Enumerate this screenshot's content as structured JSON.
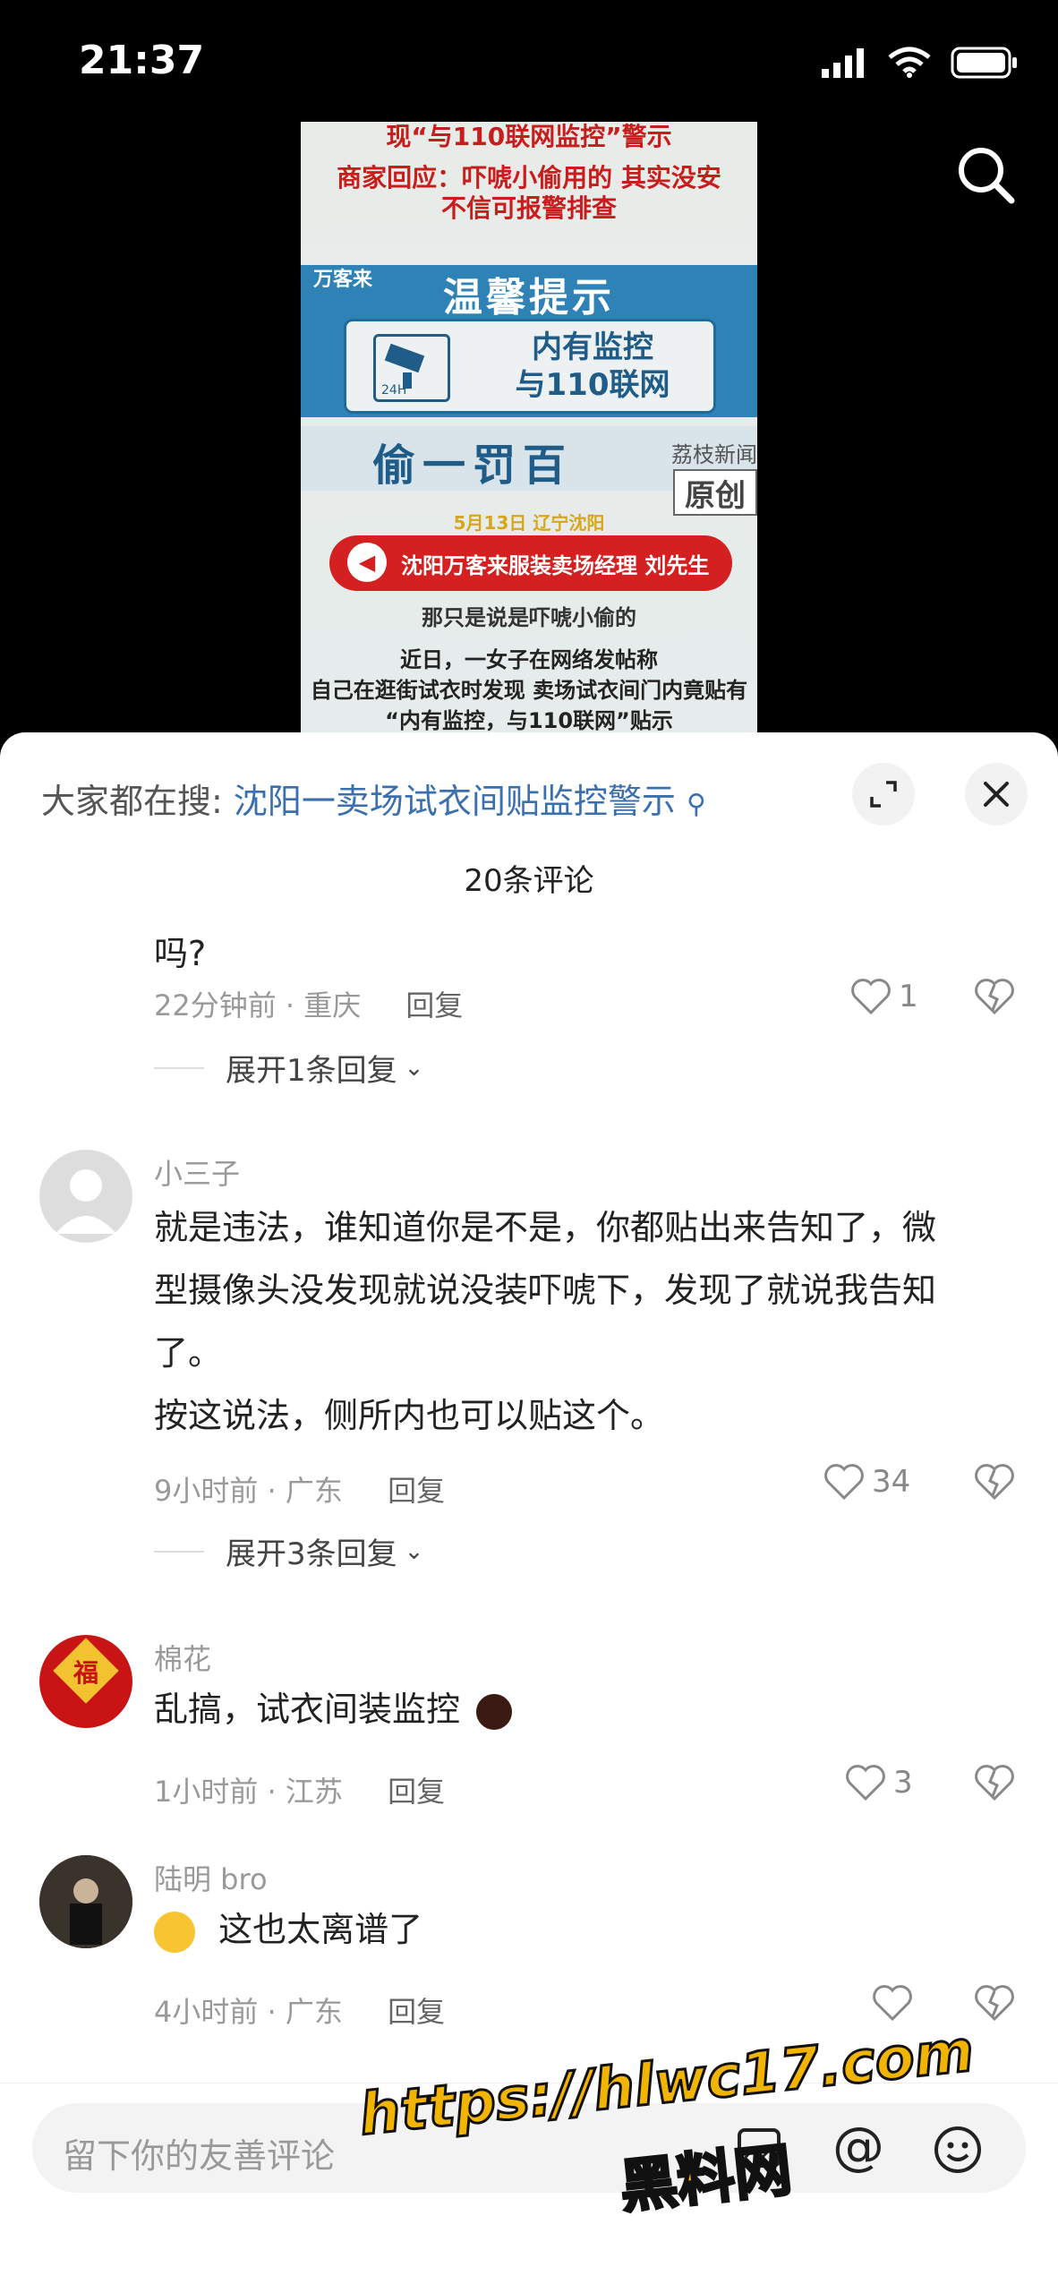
{
  "status_bar": {
    "time": "21:37"
  },
  "video": {
    "title": "现“与110联网监控”警示",
    "merchant_response": "商家回应：吓唬小偷用的 其实没安\n不信可报警排查",
    "brand": "万客来",
    "heading": "温馨提示",
    "box_text": "内有监控\n与110联网",
    "box_icon_label": "24H",
    "fine_text": "偷一罚百",
    "source": "荔枝新闻",
    "original_tag": "原创",
    "date_location": "5月13日 辽宁沈阳",
    "speaker": "沈阳万客来服装卖场经理 刘先生",
    "subtitle": "那只是说是吓唬小偷的",
    "news_text": "近日，一女子在网络发帖称\n自己在逛街试衣时发现 卖场试衣间门内竟贴有\n“内有监控，与110联网”贴示"
  },
  "sheet": {
    "hot_search_label": "大家都在搜:",
    "hot_search_link": "沈阳一卖场试衣间贴监控警示",
    "comment_count": "20条评论"
  },
  "comments": [
    {
      "body": "吗?",
      "time_location": "22分钟前 · 重庆",
      "reply_label": "回复",
      "likes": "1",
      "expand": "展开1条回复"
    },
    {
      "name": "小三子",
      "body_lines": [
        "就是违法，谁知道你是不是，你都贴出来告知了，微",
        "型摄像头没发现就说没装吓唬下，发现了就说我告知",
        "了。",
        "按这说法，侧所内也可以贴这个。"
      ],
      "time_location": "9小时前 · 广东",
      "reply_label": "回复",
      "likes": "34",
      "expand": "展开3条回复"
    },
    {
      "name": "棉花",
      "body": "乱搞，试衣间装监控",
      "time_location": "1小时前 · 江苏",
      "reply_label": "回复",
      "likes": "3"
    },
    {
      "name": "陆明 bro",
      "body": "这也太离谱了",
      "time_location": "4小时前 · 广东",
      "reply_label": "回复",
      "likes": ""
    }
  ],
  "input": {
    "placeholder": "留下你的友善评论"
  },
  "watermark": {
    "url": "https://hlwc17.com",
    "site": "黑料网"
  },
  "colors": {
    "link": "#3a6fb0",
    "watermark": "#f1b400",
    "alert_red": "#d42020",
    "sign_blue": "#2f82b6"
  }
}
